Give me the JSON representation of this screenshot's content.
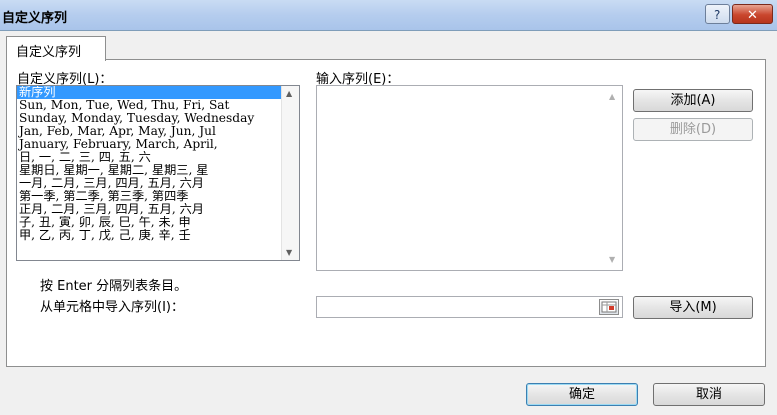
{
  "window": {
    "title": "自定义序列",
    "help_symbol": "?",
    "close_symbol": "✕"
  },
  "tab": {
    "label": "自定义序列"
  },
  "list": {
    "label": "自定义序列(L)：",
    "items": [
      "新序列",
      "Sun, Mon, Tue, Wed, Thu, Fri, Sat",
      "Sunday, Monday, Tuesday, Wednesday",
      "Jan, Feb, Mar, Apr, May, Jun, Jul",
      "January, February, March, April,",
      "日, 一, 二, 三, 四, 五, 六",
      "星期日, 星期一, 星期二, 星期三, 星",
      "一月, 二月, 三月, 四月, 五月, 六月",
      "第一季, 第二季, 第三季, 第四季",
      "正月, 二月, 三月, 四月, 五月, 六月",
      "子, 丑, 寅, 卯, 辰, 巳, 午, 未, 申",
      "甲, 乙, 丙, 丁, 戊, 己, 庚, 辛, 壬"
    ],
    "selected_index": 0
  },
  "entries": {
    "label": "输入序列(E)：",
    "value": ""
  },
  "buttons": {
    "add": "添加(A)",
    "delete": "删除(D)",
    "import": "导入(M)",
    "ok": "确定",
    "cancel": "取消"
  },
  "hint": "按 Enter 分隔列表条目。",
  "import_label": "从单元格中导入序列(I)：",
  "import_value": ""
}
